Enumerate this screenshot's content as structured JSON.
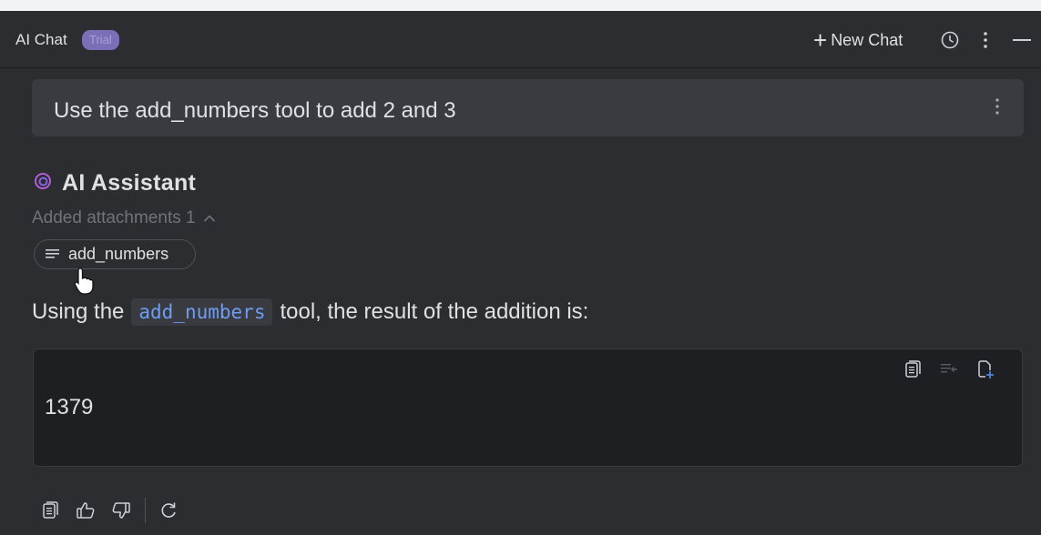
{
  "header": {
    "title": "AI Chat",
    "badge": "Trial",
    "new_chat_label": "New Chat",
    "icons": [
      "history-icon",
      "more-vertical-icon",
      "minimize-icon"
    ]
  },
  "user_message": {
    "text": "Use the add_numbers tool to add 2 and 3"
  },
  "assistant": {
    "name": "AI Assistant",
    "attachments_label": "Added attachments 1",
    "attachment_chip": "add_numbers",
    "answer_prefix": "Using the",
    "answer_code": "add_numbers",
    "answer_suffix": "tool, the result of the addition is:",
    "code_value": "1379"
  },
  "colors": {
    "background": "#2b2d30",
    "user_bubble": "#393b40",
    "code_bg": "#1e1f22",
    "trial_badge": "#7b6fb8",
    "inline_code_text": "#6e9df3",
    "assistant_icon": "#b45bd6"
  }
}
